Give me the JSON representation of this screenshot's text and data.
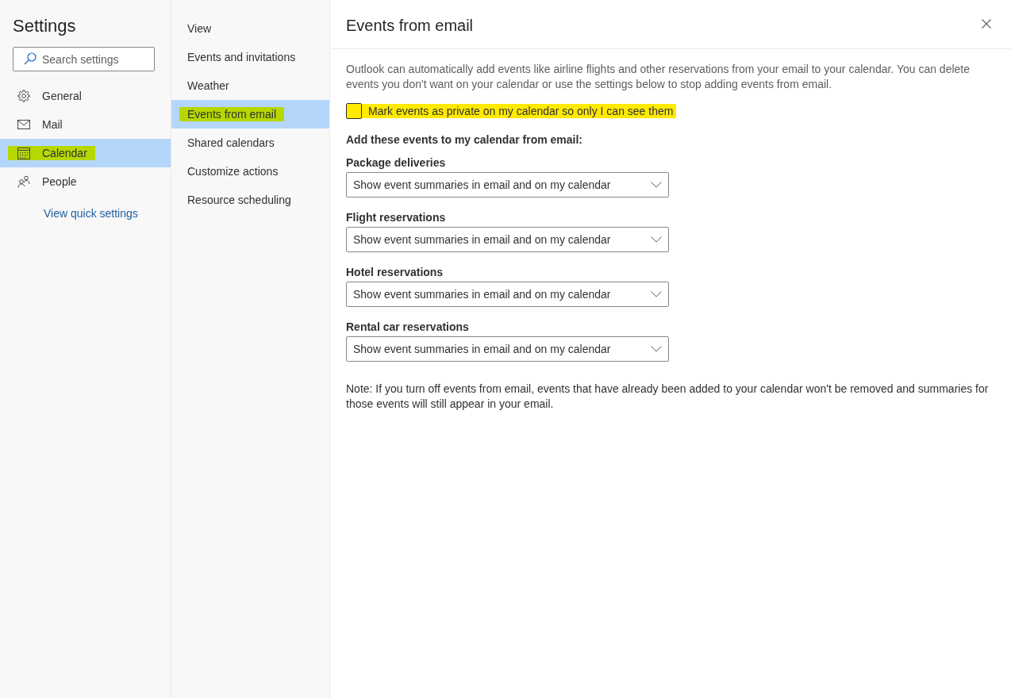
{
  "sidebar": {
    "title": "Settings",
    "search": {
      "placeholder": "Search settings"
    },
    "items": [
      {
        "label": "General",
        "selected": false,
        "highlighted": false
      },
      {
        "label": "Mail",
        "selected": false,
        "highlighted": false
      },
      {
        "label": "Calendar",
        "selected": true,
        "highlighted": true
      },
      {
        "label": "People",
        "selected": false,
        "highlighted": false
      }
    ],
    "link": "View quick settings"
  },
  "subnav": {
    "items": [
      {
        "label": "View",
        "selected": false,
        "highlighted": false
      },
      {
        "label": "Events and invitations",
        "selected": false,
        "highlighted": false
      },
      {
        "label": "Weather",
        "selected": false,
        "highlighted": false
      },
      {
        "label": "Events from email",
        "selected": true,
        "highlighted": true
      },
      {
        "label": "Shared calendars",
        "selected": false,
        "highlighted": false
      },
      {
        "label": "Customize actions",
        "selected": false,
        "highlighted": false
      },
      {
        "label": "Resource scheduling",
        "selected": false,
        "highlighted": false
      }
    ]
  },
  "panel": {
    "title": "Events from email",
    "description": "Outlook can automatically add events like airline flights and other reservations from your email to your calendar. You can delete events you don't want on your calendar or use the settings below to stop adding events from email.",
    "checkbox": {
      "label": "Mark events as private on my calendar so only I can see them",
      "checked": false,
      "highlighted": true
    },
    "section_heading": "Add these events to my calendar from email:",
    "settings": [
      {
        "label": "Package deliveries",
        "value": "Show event summaries in email and on my calendar"
      },
      {
        "label": "Flight reservations",
        "value": "Show event summaries in email and on my calendar"
      },
      {
        "label": "Hotel reservations",
        "value": "Show event summaries in email and on my calendar"
      },
      {
        "label": "Rental car reservations",
        "value": "Show event summaries in email and on my calendar"
      }
    ],
    "note": "Note: If you turn off events from email, events that have already been added to your calendar won't be removed and summaries for those events will still appear in your email."
  }
}
